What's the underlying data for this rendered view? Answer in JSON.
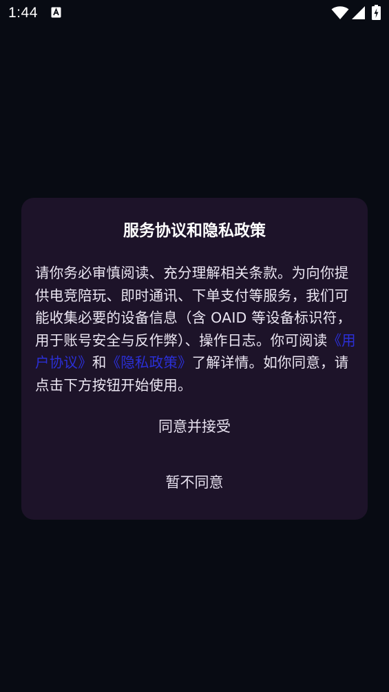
{
  "status_bar": {
    "time": "1:44",
    "notification_icon": "accessibility-a-icon",
    "wifi_icon": "wifi-icon",
    "signal_icon": "cell-signal-icon",
    "battery_icon": "battery-charging-icon"
  },
  "dialog": {
    "title": "服务协议和隐私政策",
    "body_prefix": "请你务必审慎阅读、充分理解相关条款。为向你提供电竞陪玩、即时通讯、下单支付等服务，我们可能收集必要的设备信息（含 OAID 等设备标识符，用于账号安全与反作弊）、操作日志。你可阅读",
    "user_agreement_link": "《用户协议》",
    "and_text": "和",
    "privacy_policy_link": "《隐私政策》",
    "body_suffix": "了解详情。如你同意，请点击下方按钮开始使用。",
    "agree_button": "同意并接受",
    "decline_button": "暂不同意"
  },
  "colors": {
    "background": "#080b13",
    "dialog_background": "#1d1329",
    "link": "#2b2fd6"
  }
}
